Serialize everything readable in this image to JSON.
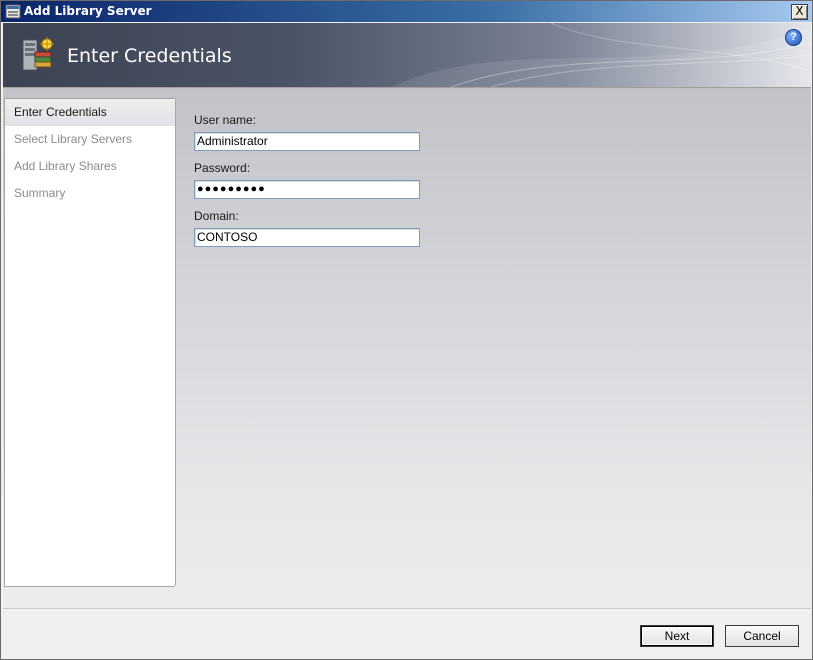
{
  "window": {
    "title": "Add Library Server",
    "close_label": "X"
  },
  "header": {
    "title": "Enter Credentials",
    "help_label": "?"
  },
  "sidebar": {
    "steps": [
      {
        "label": "Enter Credentials",
        "active": true
      },
      {
        "label": "Select Library Servers",
        "active": false
      },
      {
        "label": "Add Library Shares",
        "active": false
      },
      {
        "label": "Summary",
        "active": false
      }
    ]
  },
  "form": {
    "username_label": "User name:",
    "username_value": "Administrator",
    "password_label": "Password:",
    "password_mask": "●●●●●●●●●",
    "domain_label": "Domain:",
    "domain_value": "CONTOSO"
  },
  "footer": {
    "next_label": "Next",
    "cancel_label": "Cancel"
  }
}
